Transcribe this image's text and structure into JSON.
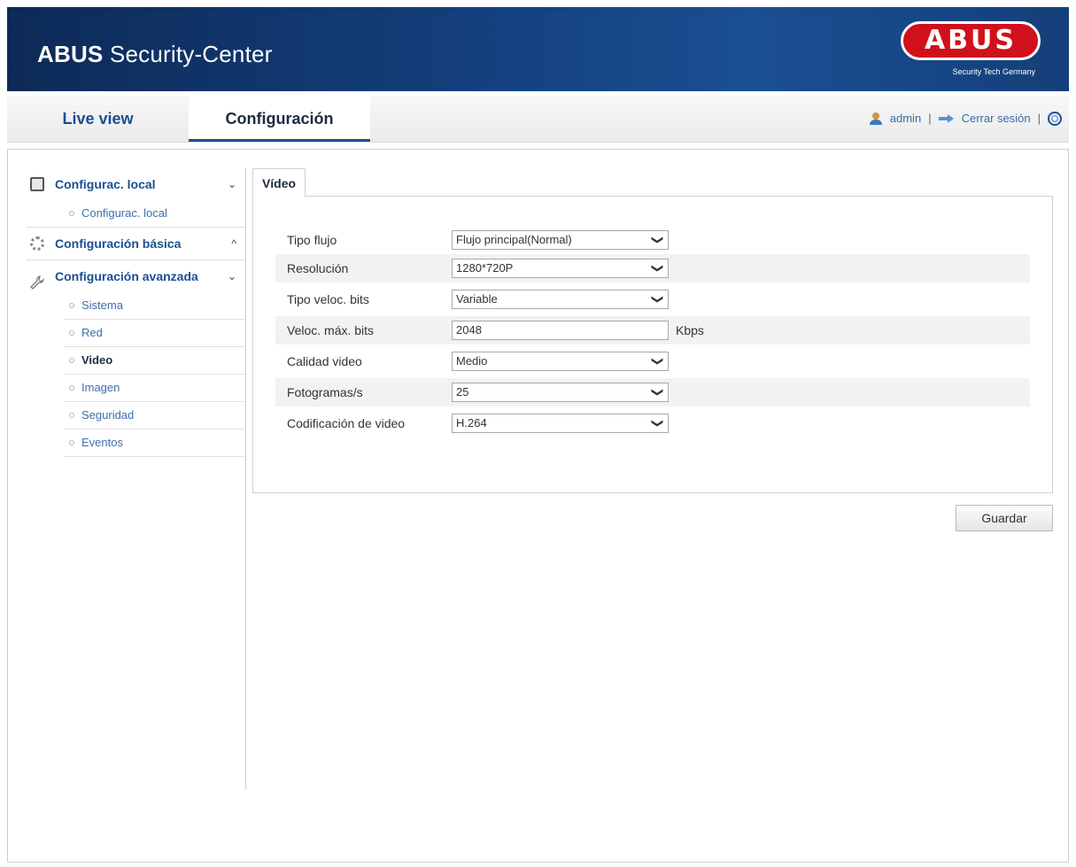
{
  "header": {
    "app_title_brand": "ABUS",
    "app_title_rest": "Security-Center",
    "logo_text": "ABUS",
    "logo_subtitle": "Security Tech Germany",
    "logo_color": "#d0111b"
  },
  "topnav": {
    "tabs": [
      {
        "label": "Live view"
      },
      {
        "label": "Configuración",
        "active": true
      }
    ],
    "user": "admin",
    "logout": "Cerrar sesión",
    "separator": "|"
  },
  "sidebar": {
    "sections": [
      {
        "label": "Configurac. local",
        "icon": "monitor-icon",
        "chevron": "⌄",
        "items": [
          {
            "label": "Configurac. local"
          }
        ]
      },
      {
        "label": "Configuración básica",
        "icon": "gear-icon",
        "chevron": "^",
        "items": []
      },
      {
        "label": "Configuración avanzada",
        "icon": "wrench-icon",
        "chevron": "⌄",
        "items": [
          {
            "label": "Sistema"
          },
          {
            "label": "Red"
          },
          {
            "label": "Video",
            "active": true
          },
          {
            "label": "Imagen"
          },
          {
            "label": "Seguridad"
          },
          {
            "label": "Eventos"
          }
        ]
      }
    ]
  },
  "main": {
    "tab_label": "Vídeo",
    "fields": [
      {
        "label": "Tipo flujo",
        "value": "Flujo principal(Normal)",
        "type": "select"
      },
      {
        "label": "Resolución",
        "value": "1280*720P",
        "type": "select"
      },
      {
        "label": "Tipo veloc. bits",
        "value": "Variable",
        "type": "select"
      },
      {
        "label": "Veloc. máx. bits",
        "value": "2048",
        "type": "text",
        "unit": "Kbps"
      },
      {
        "label": "Calidad video",
        "value": "Medio",
        "type": "select"
      },
      {
        "label": "Fotogramas/s",
        "value": "25",
        "type": "select"
      },
      {
        "label": "Codificación de video",
        "value": "H.264",
        "type": "select"
      }
    ],
    "save_label": "Guardar"
  }
}
